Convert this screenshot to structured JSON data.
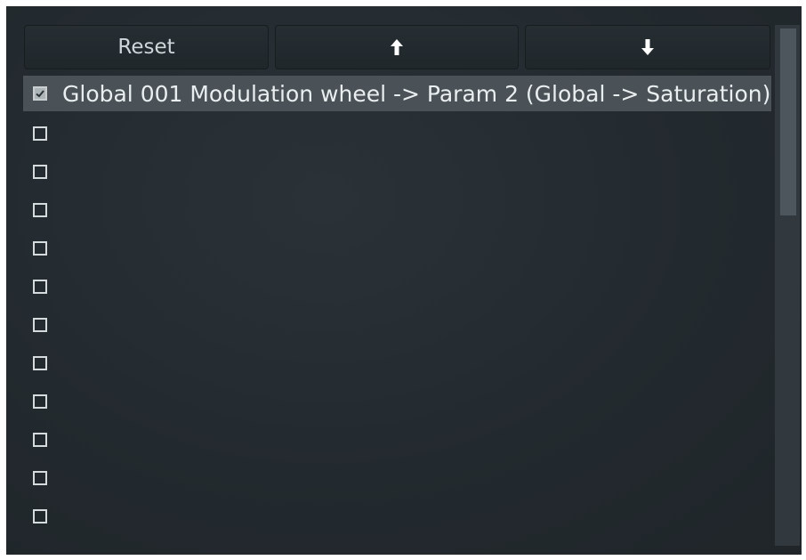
{
  "toolbar": {
    "reset_label": "Reset",
    "up_icon": "arrow-up-icon",
    "down_icon": "arrow-down-icon"
  },
  "list": {
    "rows": [
      {
        "checked": true,
        "label": "Global 001 Modulation wheel -> Param 2 (Global -> Saturation)",
        "selected": true
      },
      {
        "checked": false,
        "label": ""
      },
      {
        "checked": false,
        "label": ""
      },
      {
        "checked": false,
        "label": ""
      },
      {
        "checked": false,
        "label": ""
      },
      {
        "checked": false,
        "label": ""
      },
      {
        "checked": false,
        "label": ""
      },
      {
        "checked": false,
        "label": ""
      },
      {
        "checked": false,
        "label": ""
      },
      {
        "checked": false,
        "label": ""
      },
      {
        "checked": false,
        "label": ""
      },
      {
        "checked": false,
        "label": ""
      }
    ]
  },
  "colors": {
    "panel_bg": "#232a2f",
    "selected_row": "#4a5257",
    "text": "#e9eef0"
  }
}
